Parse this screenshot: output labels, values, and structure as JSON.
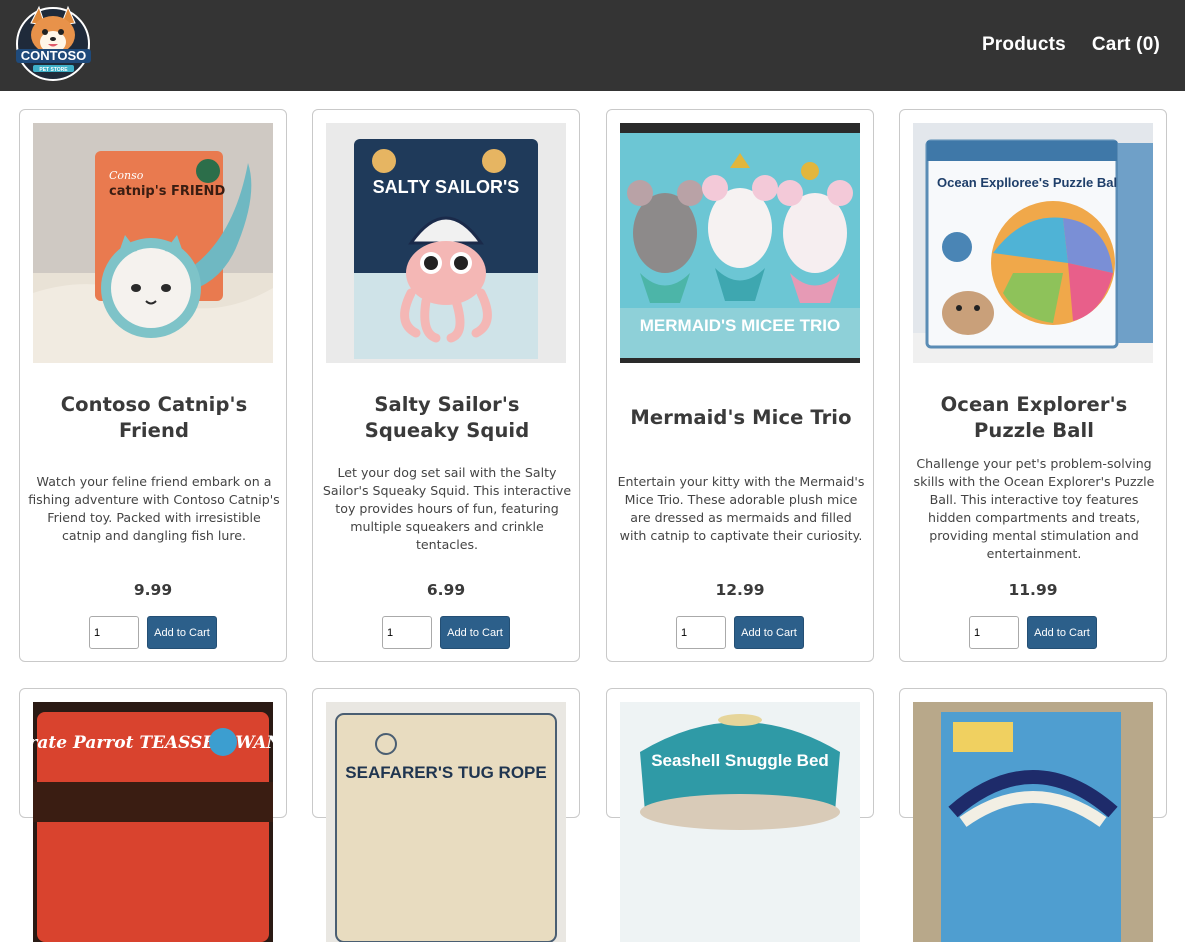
{
  "nav": {
    "brand_text": "CONTOSO",
    "brand_sub": "PET STORE",
    "products": "Products",
    "cart": "Cart (0)"
  },
  "products": [
    {
      "title": "Contoso Catnip's Friend",
      "description": "Watch your feline friend embark on a fishing adventure with Contoso Catnip's Friend toy. Packed with irresistible catnip and dangling fish lure.",
      "price": "9.99",
      "qty": "1",
      "button": "Add to Cart",
      "package_text": "catnip's FRIEND"
    },
    {
      "title": "Salty Sailor's Squeaky Squid",
      "description": "Let your dog set sail with the Salty Sailor's Squeaky Squid. This interactive toy provides hours of fun, featuring multiple squeakers and crinkle tentacles.",
      "price": "6.99",
      "qty": "1",
      "button": "Add to Cart",
      "package_text": "SALTY SAILOR'S"
    },
    {
      "title": "Mermaid's Mice Trio",
      "description": "Entertain your kitty with the Mermaid's Mice Trio. These adorable plush mice are dressed as mermaids and filled with catnip to captivate their curiosity.",
      "price": "12.99",
      "qty": "1",
      "button": "Add to Cart",
      "package_text": "MERMAID'S MICEE TRIO"
    },
    {
      "title": "Ocean Explorer's Puzzle Ball",
      "description": "Challenge your pet's problem-solving skills with the Ocean Explorer's Puzzle Ball. This interactive toy features hidden compartments and treats, providing mental stimulation and entertainment.",
      "price": "11.99",
      "qty": "1",
      "button": "Add to Cart",
      "package_text": "Ocean Explloree's Puzzle Ball"
    },
    {
      "package_text": "Pirate Parrot TEASSER WAND"
    },
    {
      "package_text": "SEAFARER'S TUG ROPE"
    },
    {
      "package_text": "Seashell Snuggle Bed"
    },
    {
      "package_text": ""
    }
  ]
}
